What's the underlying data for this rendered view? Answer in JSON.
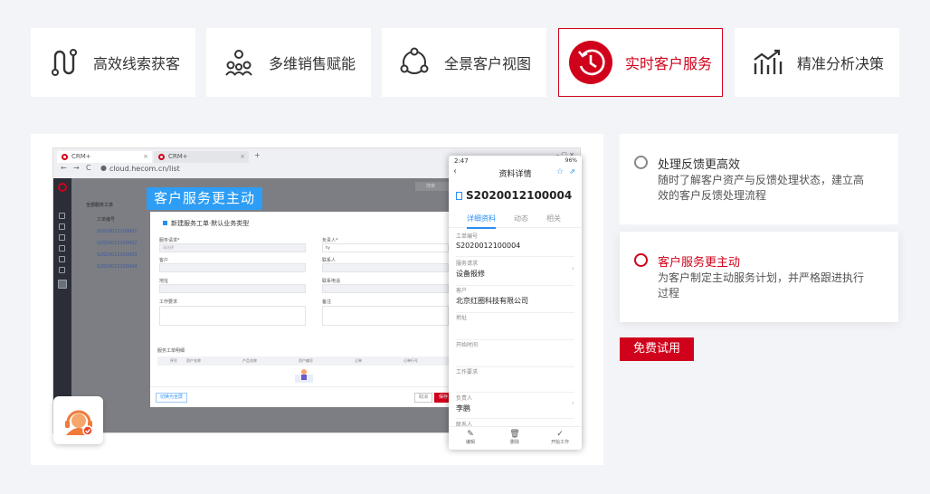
{
  "tabs": [
    {
      "label": "高效线索获客",
      "icon": "lead-path-icon"
    },
    {
      "label": "多维销售赋能",
      "icon": "team-network-icon"
    },
    {
      "label": "全景客户视图",
      "icon": "triangle-nodes-icon"
    },
    {
      "label": "实时客户服务",
      "icon": "clock-refresh-icon",
      "active": true
    },
    {
      "label": "精准分析决策",
      "icon": "chart-trend-icon"
    }
  ],
  "browser": {
    "tab1": "CRM+",
    "tab2": "CRM+",
    "url": "cloud.hecom.cn/list",
    "list_header": "全部服务工单",
    "list_col": "工单编号",
    "list_items": [
      "S2020012100001",
      "S2020012100002",
      "S2020012100003",
      "S2020012100004"
    ],
    "search_placeholder": "搜索"
  },
  "modal": {
    "title": "新建服务工单·默认业务类型",
    "labels": {
      "request": "服务请求*",
      "owner": "负责人*",
      "customer": "客户",
      "contact": "联系人",
      "address": "地址",
      "contact_phone": "联系电话",
      "requirement": "工作要求",
      "remark": "备注"
    },
    "request_value": "请选择",
    "owner_value": "hy",
    "section": "服务工单明细",
    "table_cols": [
      "序号",
      "资产名称",
      "产品名称",
      "资产编号",
      "订单",
      "订单行号"
    ],
    "btn_left": "切换为全屏",
    "btn_cancel": "取消",
    "btn_save": "保存"
  },
  "banner": "客户服务更主动",
  "phone": {
    "time": "2:47",
    "status_right": "96%",
    "title": "资料详情",
    "ticket_no": "S2020012100004",
    "tabs": [
      "详细资料",
      "动态",
      "相关"
    ],
    "fields": [
      {
        "label": "工单编号",
        "value": "S2020012100004"
      },
      {
        "label": "服务请求",
        "value": "设备报修"
      },
      {
        "label": "客户",
        "value": "北京红圈科技有限公司"
      },
      {
        "label": "地址",
        "value": ""
      },
      {
        "label": "开始时间",
        "value": ""
      },
      {
        "label": "工作要求",
        "value": ""
      },
      {
        "label": "负责人",
        "value": "李鹏"
      },
      {
        "label": "联系人",
        "value": ""
      }
    ],
    "actions": [
      {
        "label": "编辑",
        "icon": "edit-icon"
      },
      {
        "label": "删除",
        "icon": "trash-icon"
      },
      {
        "label": "开始工作",
        "icon": "check-icon"
      }
    ]
  },
  "features": [
    {
      "title": "处理反馈更高效",
      "desc": "随时了解客户资产与反馈处理状态，建立高效的客户反馈处理流程"
    },
    {
      "title": "客户服务更主动",
      "desc": "为客户制定主动服务计划，并严格跟进执行过程"
    }
  ],
  "trial_button": "免费试用",
  "colors": {
    "accent": "#d0021b",
    "blue": "#2a8ef0"
  }
}
